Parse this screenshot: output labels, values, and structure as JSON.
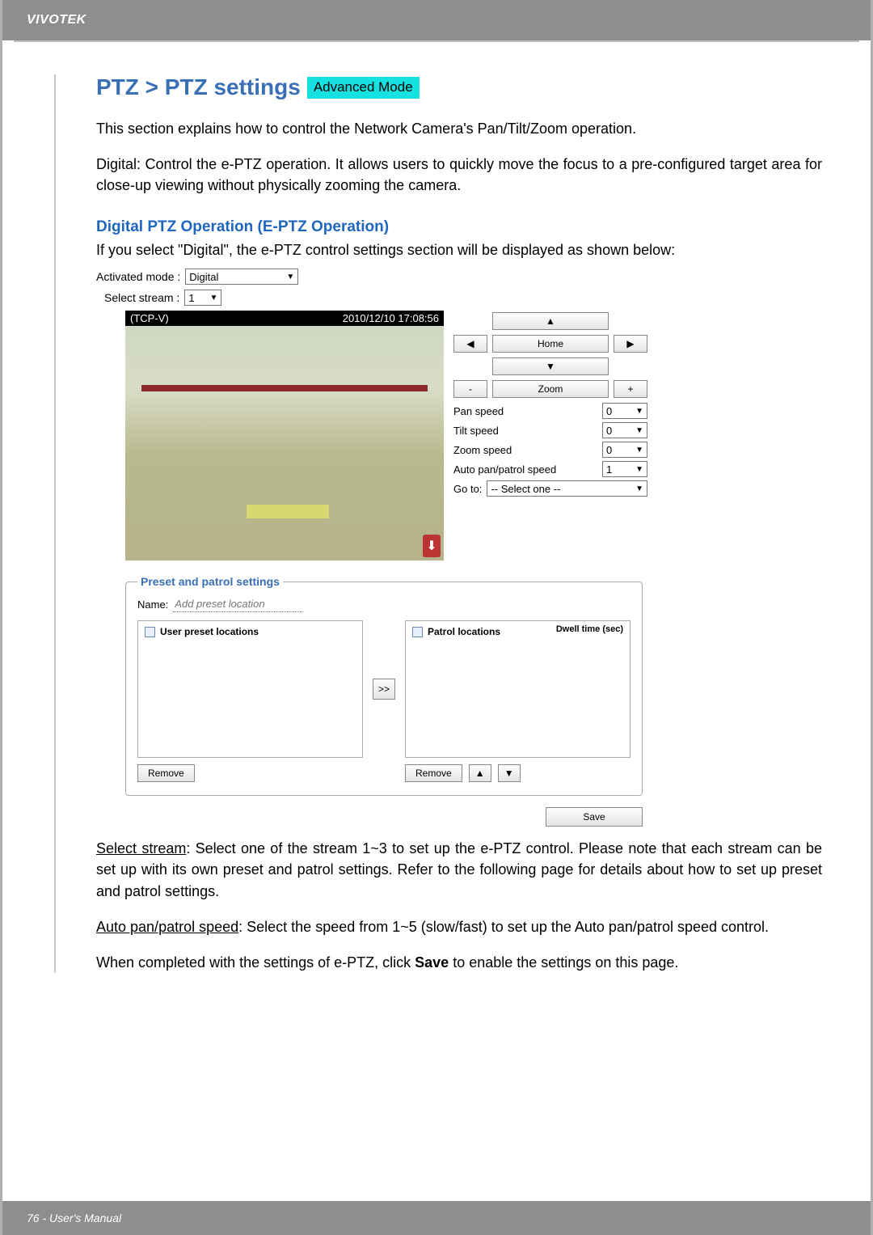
{
  "brand": "VIVOTEK",
  "title": "PTZ > PTZ settings",
  "badge": "Advanced Mode",
  "intro": "This section explains how to control the Network Camera's Pan/Tilt/Zoom operation.",
  "digital_para": "Digital: Control the e-PTZ operation. It allows users to quickly move the focus to a pre-configured target area for close-up viewing without physically zooming the camera.",
  "section_heading": "Digital PTZ Operation (E-PTZ Operation)",
  "section_lead": "If you select \"Digital\", the e-PTZ control settings section will be displayed as shown below:",
  "mode": {
    "label": "Activated mode :",
    "value": "Digital"
  },
  "stream": {
    "label": "Select stream :",
    "value": "1"
  },
  "video": {
    "name": "(TCP-V)",
    "timestamp": "2010/12/10  17:08:56"
  },
  "controls": {
    "home": "Home",
    "zoom": "Zoom",
    "pan_speed": {
      "label": "Pan speed",
      "value": "0"
    },
    "tilt_speed": {
      "label": "Tilt speed",
      "value": "0"
    },
    "zoom_speed": {
      "label": "Zoom speed",
      "value": "0"
    },
    "auto_speed": {
      "label": "Auto pan/patrol speed",
      "value": "1"
    },
    "goto": {
      "label": "Go to:",
      "value": "-- Select one --"
    }
  },
  "preset": {
    "legend": "Preset and patrol settings",
    "name_label": "Name:",
    "name_placeholder": "Add preset location",
    "user_list": "User preset locations",
    "patrol_list": "Patrol locations",
    "dwell": "Dwell time (sec)",
    "remove": "Remove",
    "save": "Save"
  },
  "body": {
    "select_stream_label": "Select stream",
    "select_stream_rest": ": Select one of the stream 1~3 to set up the e-PTZ control. Please note that each stream can be set up with its own preset and patrol settings. Refer to the following page for details about how to set up preset and patrol settings.",
    "auto_label": "Auto pan/patrol speed",
    "auto_rest": ": Select the speed from 1~5 (slow/fast) to set up the Auto pan/patrol speed control.",
    "save_note_pre": "When completed with the settings of e-PTZ, click ",
    "save_note_bold": "Save",
    "save_note_post": " to enable the settings on this page."
  },
  "footer": "76 - User's Manual"
}
